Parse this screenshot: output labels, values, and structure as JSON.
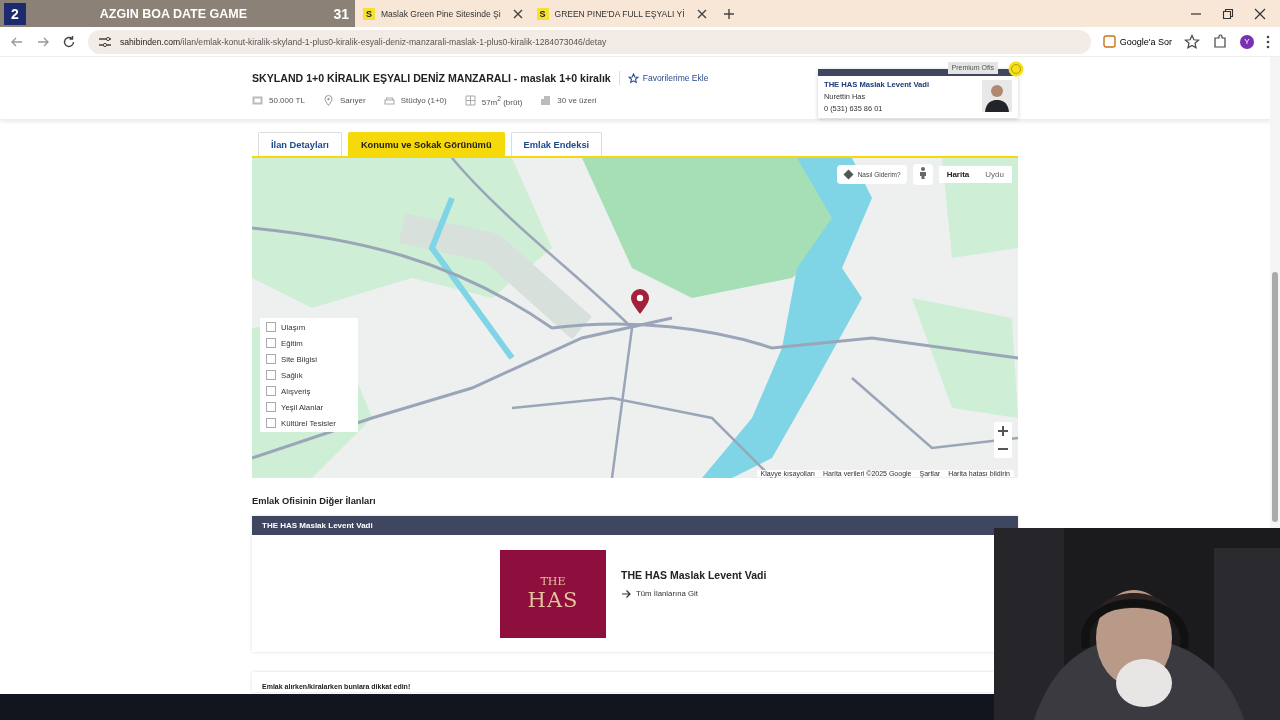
{
  "stream_overlay": {
    "badge": "2",
    "title": "AZGIN BOA DATE GAME",
    "count": "31"
  },
  "browser": {
    "tabs": [
      {
        "icon_letter": "S",
        "title": "Maslak Green Pine Sitesinde Şi",
        "selected": false
      },
      {
        "icon_letter": "S",
        "title": "GREEN PINE'DA FULL EŞYALI Yİ",
        "selected": false
      }
    ],
    "url_host": "sahibinden.com",
    "url_path": "/ilan/emlak-konut-kiralik-skyland-1-plus0-kiralik-esyali-deniz-manzarali-maslak-1-plus0-kiralik-1284073046/detay",
    "ask_button": "Google'a Sor",
    "profile_initial": "Y"
  },
  "listing": {
    "title": "SKYLAND 1+0 KİRALIK EŞYALI DENİZ MANZARALI - maslak 1+0 kiralık",
    "favorite": "Favorilerime Ekle",
    "facts": [
      {
        "kind": "price",
        "text": "50.000 TL"
      },
      {
        "kind": "location",
        "text": "Sarıyer"
      },
      {
        "kind": "rooms",
        "text": "Stüdyo (1+0)"
      },
      {
        "kind": "area",
        "text": "57m$^{2}$ (brüt)"
      },
      {
        "kind": "age",
        "text": "30 ve üzeri"
      }
    ]
  },
  "agent": {
    "badge": "Premium Ofis",
    "office": "THE HAS Maslak Levent Vadi",
    "name": "Nurettin Has",
    "phone": "0 (531) 635 86 01"
  },
  "detail_tabs": [
    {
      "label": "İlan Detayları",
      "selected": false
    },
    {
      "label": "Konumu ve Sokak Görünümü",
      "selected": true
    },
    {
      "label": "Emlak Endeksi",
      "selected": false
    }
  ],
  "map": {
    "kind": "picture",
    "directions": "Nasıl Giderim?",
    "map_types": [
      {
        "label": "Harita",
        "selected": true
      },
      {
        "label": "Uydu",
        "selected": false
      }
    ],
    "layers": [
      {
        "label": "Ulaşım",
        "checked": false
      },
      {
        "label": "Eğitim",
        "checked": false
      },
      {
        "label": "Site Bilgisi",
        "checked": false
      },
      {
        "label": "Sağlık",
        "checked": false
      },
      {
        "label": "Alışveriş",
        "checked": false
      },
      {
        "label": "Yeşil Alanlar",
        "checked": false
      },
      {
        "label": "Kültürel Tesisler",
        "checked": false
      }
    ],
    "footer": [
      "Klavye kısayolları",
      "Harita verileri ©2025 Google",
      "Şartlar",
      "Harita hatası bildirin"
    ]
  },
  "other_listings": {
    "heading": "Emlak Ofisinin Diğer İlanları",
    "office_bar": "THE HAS Maslak Levent Vadi",
    "logo_top": "THE",
    "logo_main": "HAS",
    "office_name": "THE HAS Maslak Levent Vadi",
    "link": "Tüm İlanlarına Git"
  },
  "notice": {
    "title": "Emlak alırken/kiralarken bunlara dikkat edin!"
  }
}
